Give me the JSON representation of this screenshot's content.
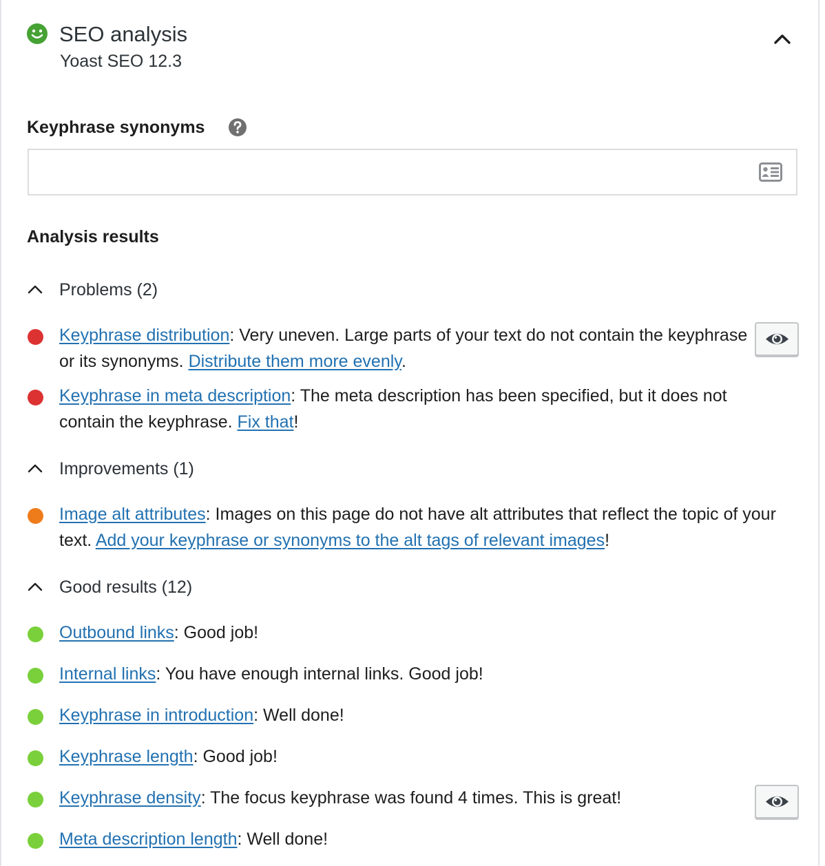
{
  "header": {
    "title": "SEO analysis",
    "subtitle": "Yoast SEO 12.3",
    "score_color": "#46a234",
    "toggle_icon": "chevron-up-icon"
  },
  "synonyms": {
    "label": "Keyphrase synonyms",
    "help_icon": "question-mark-icon",
    "value": "",
    "field_icon": "contact-card-icon"
  },
  "results": {
    "heading": "Analysis results",
    "groups": [
      {
        "label": "Problems (2)",
        "items": [
          {
            "color": "#dc3232",
            "link": "Keyphrase distribution",
            "text": ": Very uneven. Large parts of your text do not contain the keyphrase or its synonyms. ",
            "link2": "Distribute them more evenly",
            "suffix": ".",
            "has_eye": true
          },
          {
            "color": "#dc3232",
            "link": "Keyphrase in meta description",
            "text": ": The meta description has been specified, but it does not contain the keyphrase. ",
            "link2": "Fix that",
            "suffix": "!",
            "has_eye": false
          }
        ]
      },
      {
        "label": "Improvements (1)",
        "items": [
          {
            "color": "#ee7c1b",
            "link": "Image alt attributes",
            "text": ": Images on this page do not have alt attributes that reflect the topic of your text. ",
            "link2": "Add your keyphrase or synonyms to the alt tags of relevant images",
            "suffix": "!",
            "has_eye": false
          }
        ]
      },
      {
        "label": "Good results (12)",
        "items": [
          {
            "color": "#7ad03a",
            "link": "Outbound links",
            "text": ": Good job!",
            "has_eye": false
          },
          {
            "color": "#7ad03a",
            "link": "Internal links",
            "text": ": You have enough internal links. Good job!",
            "has_eye": false
          },
          {
            "color": "#7ad03a",
            "link": "Keyphrase in introduction",
            "text": ": Well done!",
            "has_eye": false
          },
          {
            "color": "#7ad03a",
            "link": "Keyphrase length",
            "text": ": Good job!",
            "has_eye": false
          },
          {
            "color": "#7ad03a",
            "link": "Keyphrase density",
            "text": ": The focus keyphrase was found 4 times. This is great!",
            "has_eye": true
          },
          {
            "color": "#7ad03a",
            "link": "Meta description length",
            "text": ": Well done!",
            "has_eye": false
          }
        ]
      }
    ]
  }
}
